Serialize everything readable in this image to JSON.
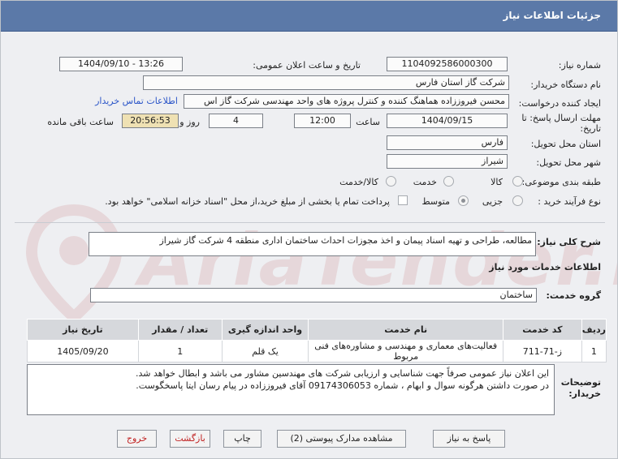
{
  "window": {
    "title": "جزئیات اطلاعات نیاز"
  },
  "form": {
    "need_number_label": "شماره نیاز:",
    "need_number": "1104092586000300",
    "announce_label": "تاریخ و ساعت اعلان عمومی:",
    "announce_value": "1404/09/10 - 13:26",
    "buyer_org_label": "نام دستگاه خریدار:",
    "buyer_org": "شرکت گاز استان فارس",
    "requester_label": "ایجاد کننده درخواست:",
    "requester": "محسن فیروززاده هماهنگ کننده و کنترل پروژه های واحد مهندسی شرکت گاز اس",
    "contact_link": "اطلاعات تماس خریدار",
    "deadline_label_1": "مهلت ارسال پاسخ: تا",
    "deadline_label_2": "تاریخ:",
    "deadline_date": "1404/09/15",
    "time_label": "ساعت",
    "deadline_time": "12:00",
    "days_value": "4",
    "days_and_label": "روز و",
    "remaining_time": "20:56:53",
    "remaining_label": "ساعت باقی مانده",
    "province_label": "استان محل تحویل:",
    "province": "فارس",
    "city_label": "شهر محل تحویل:",
    "city": "شیراز",
    "category_label": "طبقه بندی موضوعی:",
    "category_options": [
      "کالا",
      "خدمت",
      "کالا/خدمت"
    ],
    "purchase_type_label": "نوع فرآیند خرید :",
    "purchase_type_options": [
      "جزیی",
      "متوسط"
    ],
    "payment_note": "پرداخت تمام یا بخشی از مبلغ خرید،از محل \"اسناد خزانه اسلامی\" خواهد بود."
  },
  "summary": {
    "label": "شرح کلی نیاز:",
    "text": "مطالعه، طراحی و تهیه اسناد پیمان و اخذ مجوزات احداث ساختمان اداری منطقه 4 شرکت گاز شیراز"
  },
  "services": {
    "section_title": "اطلاعات خدمات مورد نیاز",
    "group_label": "گروه خدمت:",
    "group_value": "ساختمان",
    "columns": [
      "ردیف",
      "کد خدمت",
      "نام خدمت",
      "واحد اندازه گیری",
      "تعداد / مقدار",
      "تاریخ نیاز"
    ],
    "rows": [
      {
        "row": "1",
        "code": "ز-71-711",
        "name": "فعالیت‌های معماری و مهندسی و مشاوره‌های فنی مربوط",
        "unit": "یک قلم",
        "qty": "1",
        "date": "1405/09/20"
      }
    ]
  },
  "buyer_notes": {
    "label_1": "توضیحات",
    "label_2": "خریدار:",
    "line1": "این اعلان نیاز عمومی صرفاً جهت شناسایی و ارزیابی شرکت های مهندسین مشاور می باشد و ابطال خواهد شد.",
    "line2": "در صورت داشتن هرگونه سوال و ابهام ، شماره 09174306053 آقای فیروززاده در پیام رسان ایتا پاسخگوست."
  },
  "buttons": {
    "reply": "پاسخ به نیاز",
    "attachments": "مشاهده مدارک پیوستی (2)",
    "print": "چاپ",
    "back": "بازگشت",
    "exit": "خروج"
  },
  "colors": {
    "titlebar": "#5b79a8",
    "link": "#2b55c8",
    "remaining_bg": "#efe1b3",
    "exit_text": "#c02020"
  }
}
